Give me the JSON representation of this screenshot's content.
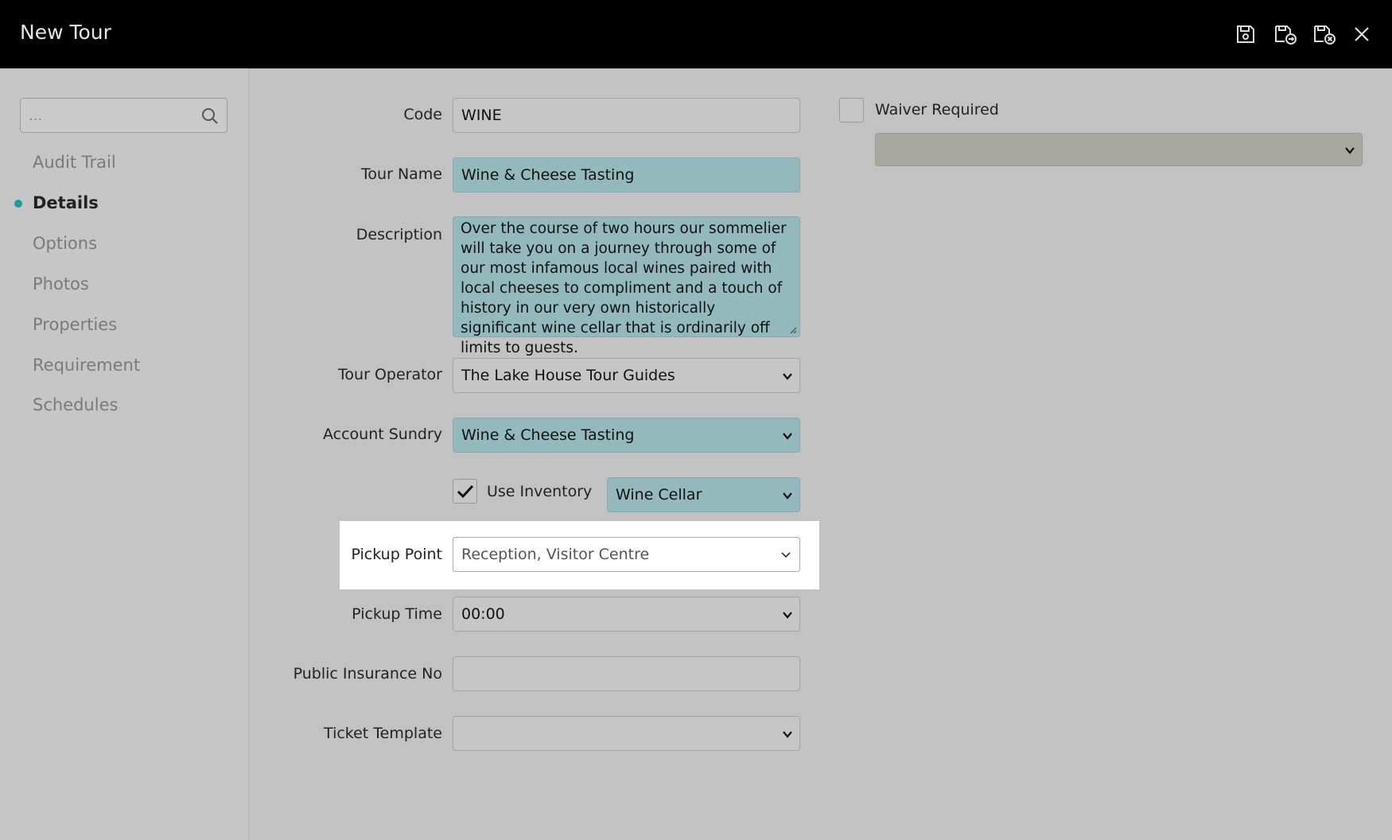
{
  "window": {
    "title": "New Tour"
  },
  "toolbar": {
    "save_icon": "save-icon",
    "save_and_new_icon": "save-and-new-icon",
    "save_and_close_icon": "save-and-close-icon",
    "close_icon": "close-icon"
  },
  "sidebar": {
    "search": {
      "placeholder": "..."
    },
    "items": [
      {
        "label": "Audit Trail",
        "active": false
      },
      {
        "label": "Details",
        "active": true
      },
      {
        "label": "Options",
        "active": false
      },
      {
        "label": "Photos",
        "active": false
      },
      {
        "label": "Properties",
        "active": false
      },
      {
        "label": "Requirement",
        "active": false
      },
      {
        "label": "Schedules",
        "active": false
      }
    ]
  },
  "form": {
    "code": {
      "label": "Code",
      "value": "WINE"
    },
    "tour_name": {
      "label": "Tour Name",
      "value": "Wine & Cheese Tasting"
    },
    "description": {
      "label": "Description",
      "value": "Over the course of two hours our sommelier will take you on a journey through some of our most infamous local wines paired with local cheeses to compliment and a touch of history in our very own historically significant wine cellar that is ordinarily off limits to guests."
    },
    "tour_operator": {
      "label": "Tour Operator",
      "value": "The Lake House Tour Guides"
    },
    "account_sundry": {
      "label": "Account Sundry",
      "value": "Wine & Cheese Tasting"
    },
    "use_inventory": {
      "label": "Use Inventory",
      "checked": true,
      "location": "Wine Cellar"
    },
    "pickup_point": {
      "label": "Pickup Point",
      "value": "Reception, Visitor Centre"
    },
    "pickup_time": {
      "label": "Pickup Time",
      "value": "00:00"
    },
    "public_insurance_no": {
      "label": "Public Insurance No",
      "value": ""
    },
    "ticket_template": {
      "label": "Ticket Template",
      "value": ""
    },
    "waiver_required": {
      "label": "Waiver Required",
      "checked": false,
      "value": ""
    }
  },
  "colors": {
    "accent": "#1a9aa3",
    "required_field": "#93b9bc",
    "topbar": "#000000"
  }
}
